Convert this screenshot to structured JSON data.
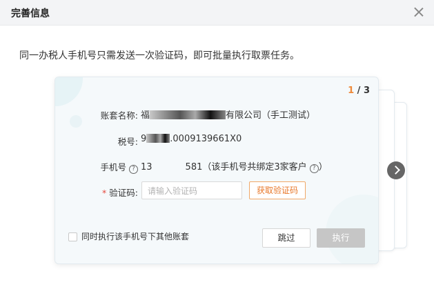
{
  "dialog": {
    "title": "完善信息",
    "intro": "同一办税人手机号只需发送一次验证码，即可批量执行取票任务。"
  },
  "card": {
    "pager": {
      "current": "1",
      "total": "/ 3"
    },
    "account": {
      "label": "账套名称:",
      "value_prefix": "福",
      "value_suffix": "有限公司（手工测试）"
    },
    "tax": {
      "label": "税号:",
      "value_prefix": "9",
      "value_suffix": ".0009139661X0"
    },
    "phone": {
      "label": "手机号",
      "value_prefix": "13",
      "value_suffix": "581（该手机号共绑定3家客户",
      "close_paren": "）"
    },
    "code": {
      "required_mark": "*",
      "label": "验证码:",
      "placeholder": "请输入验证码",
      "get_code_label": "获取验证码"
    },
    "same_phone_checkbox_label": "同时执行该手机号下其他账套",
    "skip_label": "跳过",
    "execute_label": "执行"
  },
  "icons": {
    "close": "close-icon",
    "help": "question-circle-icon",
    "next": "chevron-right-icon"
  },
  "colors": {
    "accent": "#e8782a",
    "disabled": "#c6c6c6",
    "required": "#e5483d"
  }
}
